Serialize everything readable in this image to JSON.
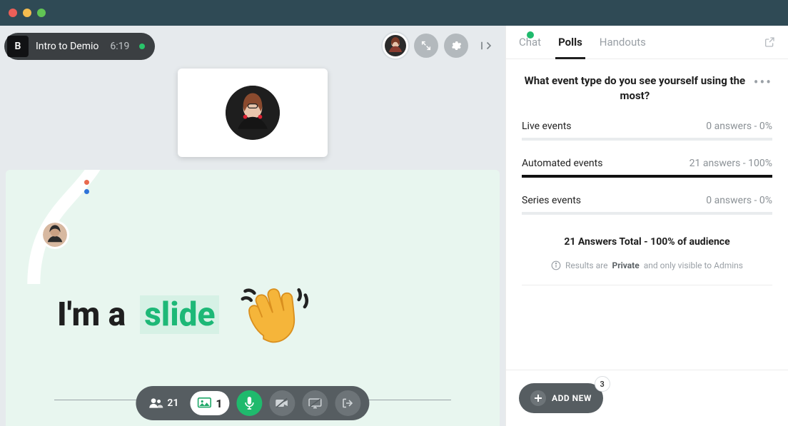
{
  "header": {
    "brand_letter": "B",
    "session_title": "Intro to Demio",
    "session_time": "6:19"
  },
  "slide": {
    "text_prefix": "I'm a",
    "text_highlight": "slide"
  },
  "toolbar": {
    "attendee_count": "21",
    "media_count": "1"
  },
  "panel": {
    "tabs": {
      "chat": "Chat",
      "polls": "Polls",
      "handouts": "Handouts"
    },
    "poll": {
      "question": "What event type do you see yourself using the most?",
      "options": [
        {
          "label": "Live events",
          "stat": "0 answers - 0%",
          "pct": 0
        },
        {
          "label": "Automated events",
          "stat": "21 answers - 100%",
          "pct": 100
        },
        {
          "label": "Series events",
          "stat": "0 answers - 0%",
          "pct": 0
        }
      ],
      "totals": "21 Answers Total - 100% of audience",
      "privacy_prefix": "Results are",
      "privacy_bold": "Private",
      "privacy_suffix": "and only visible to Admins"
    },
    "add_new_label": "ADD NEW",
    "add_new_badge": "3"
  }
}
